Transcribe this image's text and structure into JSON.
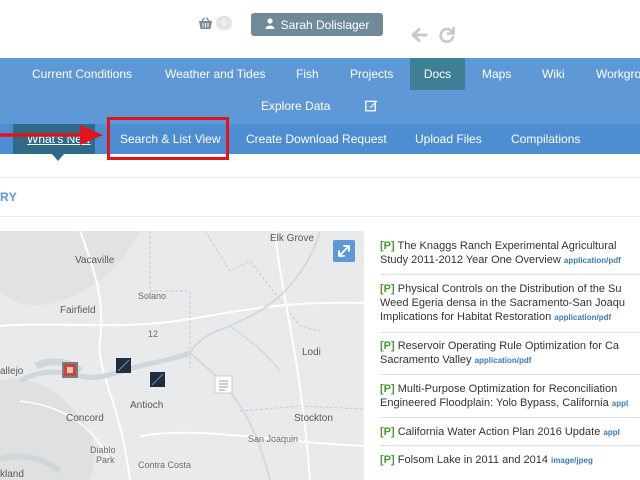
{
  "header": {
    "cart_count": "0",
    "user_name": "Sarah Dolislager"
  },
  "nav_primary": {
    "items": [
      "Current Conditions",
      "Weather and Tides",
      "Fish",
      "Projects",
      "Docs",
      "Maps",
      "Wiki",
      "Workgro"
    ],
    "active": "Docs",
    "row2": "Explore Data"
  },
  "nav_secondary": {
    "items": [
      "What's New",
      "Search & List View",
      "Create Download Request",
      "Upload Files",
      "Compilations"
    ]
  },
  "section": {
    "title": "RY"
  },
  "map": {
    "labels": [
      "Elk Grove",
      "Vacaville",
      "Solano",
      "Fairfield",
      "12",
      "Lodi",
      "allejo",
      "Antioch",
      "Concord",
      "Stockton",
      "Diablo",
      "Park",
      "San Joaquin",
      "Contra Costa",
      "kland"
    ]
  },
  "documents": [
    {
      "tag": "[P]",
      "lines": [
        "The Knaggs Ranch Experimental Agricultural",
        "Study 2011-2012 Year One Overview"
      ],
      "mime": "application/pdf"
    },
    {
      "tag": "[P]",
      "lines": [
        "Physical Controls on the Distribution of the Su",
        "Weed Egeria densa in the Sacramento-San Joaqu",
        "Implications for Habitat Restoration"
      ],
      "mime": "application/pdf"
    },
    {
      "tag": "[P]",
      "lines": [
        "Reservoir Operating Rule Optimization for Ca",
        "Sacramento Valley"
      ],
      "mime": "application/pdf"
    },
    {
      "tag": "[P]",
      "lines": [
        "Multi-Purpose Optimization for Reconciliation",
        "Engineered Floodplain: Yolo Bypass, California"
      ],
      "mime": "appl"
    },
    {
      "tag": "[P]",
      "lines": [
        "California Water Action Plan 2016 Update"
      ],
      "mime": "appl"
    },
    {
      "tag": "[P]",
      "lines": [
        "Folsom Lake in 2011 and 2014"
      ],
      "mime": "image/jpeg"
    }
  ],
  "colors": {
    "nav_primary": "#5e98d6",
    "nav_secondary": "#4d8dd2",
    "active_tab": "#3f7f96",
    "highlight": "#e3131b",
    "tag_green": "#4a9a2f",
    "mime_blue": "#3a7bb8"
  },
  "icons": [
    "basket-icon",
    "user-icon",
    "back-arrow-icon",
    "reload-icon",
    "edit-icon",
    "expand-icon",
    "red-arrow-icon"
  ]
}
